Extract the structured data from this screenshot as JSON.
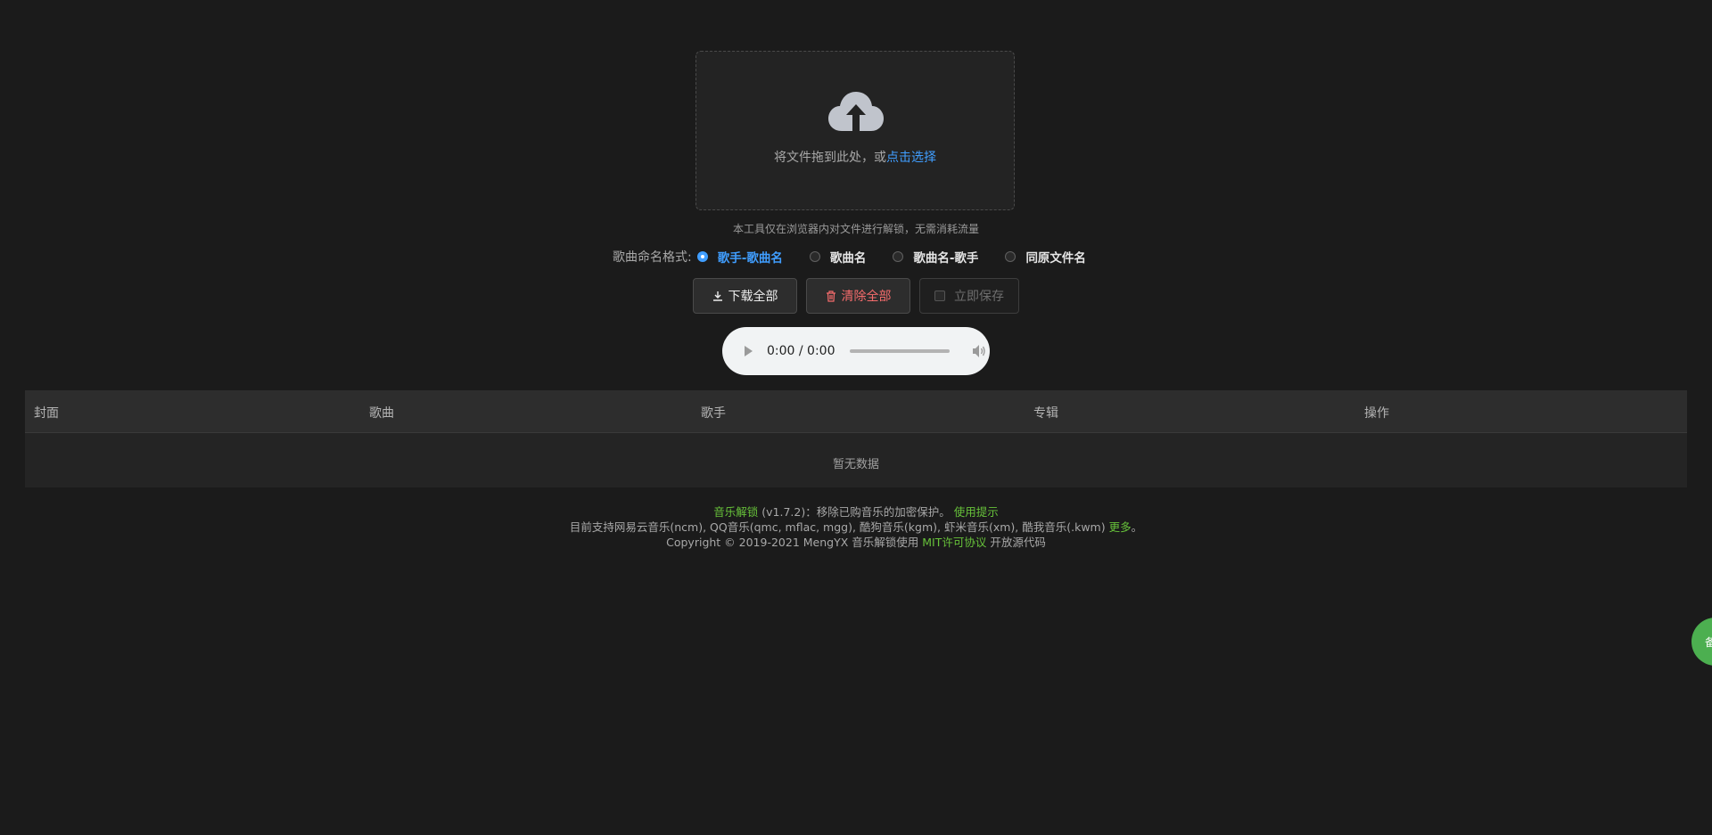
{
  "upload": {
    "icon": "upload-cloud-icon",
    "text_prefix": "将文件拖到此处，或",
    "text_link": "点击选择"
  },
  "tip": "本工具仅在浏览器内对文件进行解锁，无需消耗流量",
  "naming": {
    "label": "歌曲命名格式:",
    "options": [
      {
        "label": "歌手-歌曲名",
        "checked": true
      },
      {
        "label": "歌曲名",
        "checked": false
      },
      {
        "label": "歌曲名-歌手",
        "checked": false
      },
      {
        "label": "同原文件名",
        "checked": false
      }
    ]
  },
  "actions": {
    "download_all": "下载全部",
    "clear_all": "清除全部",
    "save_immediately": "立即保存"
  },
  "audio": {
    "time": "0:00 / 0:00"
  },
  "table": {
    "columns": [
      "封面",
      "歌曲",
      "歌手",
      "专辑",
      "操作"
    ],
    "empty_text": "暂无数据"
  },
  "footer": {
    "app_name": "音乐解锁",
    "version_desc": "(v1.7.2)：移除已购音乐的加密保护。",
    "usage_tip": "使用提示",
    "supported": "目前支持网易云音乐(ncm), QQ音乐(qmc, mflac, mgg), 酷狗音乐(kgm), 虾米音乐(xm), 酷我音乐(.kwm)",
    "more": "更多",
    "period": "。",
    "copyright": "Copyright © 2019-2021 MengYX 音乐解锁使用",
    "license": "MIT许可协议",
    "open_source": "开放源代码"
  },
  "float_badge": "备",
  "colors": {
    "background": "#1b1b1b",
    "accent_blue": "#409eff",
    "danger": "#f56c6c",
    "green": "#67c23a"
  }
}
